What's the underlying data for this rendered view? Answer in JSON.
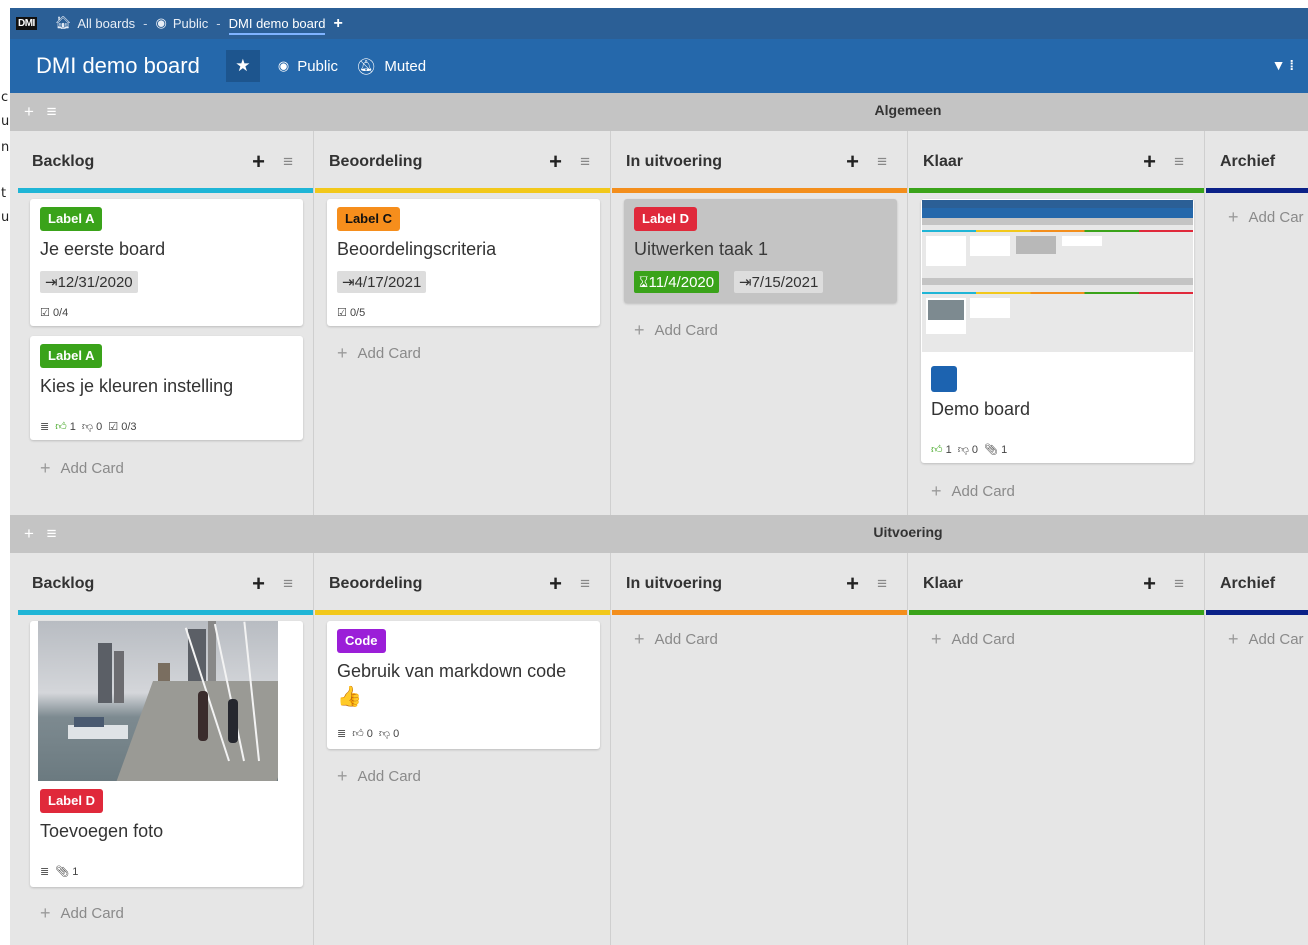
{
  "gutter": [
    "c",
    "u",
    "n",
    "t",
    "u"
  ],
  "topbar": {
    "logo": "DMI",
    "crumbs": [
      "All boards",
      "Public",
      "DMI demo board"
    ],
    "separator": "-",
    "add": "+"
  },
  "header": {
    "title": "DMI demo board",
    "visibility": "Public",
    "watch": "Muted"
  },
  "swimlanes": [
    {
      "title": "Algemeen"
    },
    {
      "title": "Uitvoering"
    }
  ],
  "lists": [
    {
      "title": "Backlog",
      "color": "#1fb5d6"
    },
    {
      "title": "Beoordeling",
      "color": "#f2c81b"
    },
    {
      "title": "In uitvoering",
      "color": "#f38e1c"
    },
    {
      "title": "Klaar",
      "color": "#3aa31a"
    },
    {
      "title": "Archief",
      "color": "#0b2188"
    }
  ],
  "add_card": "Add Card",
  "add_card_cut": "Add Car",
  "cards": {
    "c1": {
      "label": "Label A",
      "label_color": "#3aa31a",
      "title": "Je eerste board",
      "due": "12/31/2020",
      "checklist": "0/4"
    },
    "c2": {
      "label": "Label A",
      "label_color": "#3aa31a",
      "title": "Kies je kleuren instelling",
      "votes_up": "1",
      "votes_down": "0",
      "checklist": "0/3"
    },
    "c3": {
      "label": "Label C",
      "label_color": "#f68e1c",
      "title": "Beoordelingscriteria",
      "due": "4/17/2021",
      "checklist": "0/5"
    },
    "c4": {
      "label": "Label D",
      "label_color": "#e0293b",
      "title": "Uitwerken taak 1",
      "start": "11/4/2020",
      "due": "7/15/2021"
    },
    "c5": {
      "title": "Demo board",
      "color_square": "#1c63b0",
      "votes_up": "1",
      "votes_down": "0",
      "attachments": "1"
    },
    "c6": {
      "label": "Label D",
      "label_color": "#e0293b",
      "title": "Toevoegen foto",
      "attachments": "1"
    },
    "c7": {
      "label": "Code",
      "label_color": "#9b1ed8",
      "title": "Gebruik van markdown code",
      "emoji": "👍",
      "votes_up": "0",
      "votes_down": "0"
    }
  }
}
